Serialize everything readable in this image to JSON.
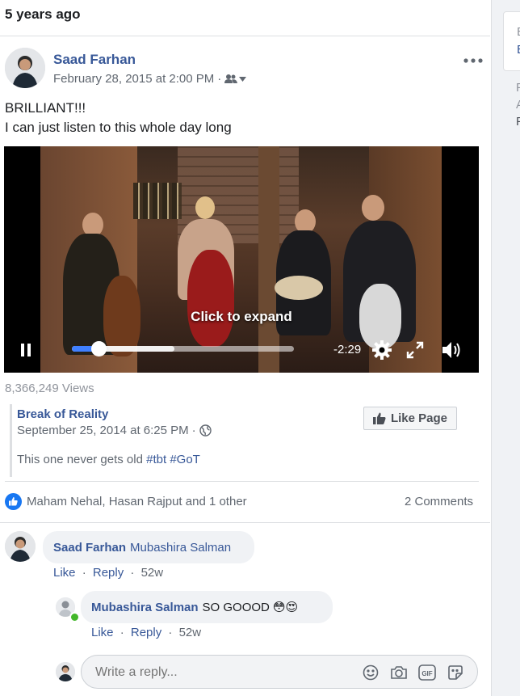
{
  "header": {
    "timeago": "5 years ago"
  },
  "post": {
    "author": "Saad Farhan",
    "date": "February 28, 2015 at 2:00 PM",
    "date_sep": "·",
    "text_line1": "BRILLIANT!!!",
    "text_line2": "I can just listen to this whole day long",
    "more_icon": "ellipsis-icon",
    "privacy_icon": "friends-icon"
  },
  "video": {
    "overlay_text": "Click to expand",
    "time_remaining": "-2:29",
    "progress_fraction": 0.12,
    "buffered_fraction": 0.46
  },
  "views": "8,366,249 Views",
  "shared_page": {
    "name": "Break of Reality",
    "date": "September 25, 2014 at 6:25 PM",
    "date_sep": "·",
    "text": "This one never gets old",
    "hashtags": [
      "#tbt",
      "#GoT"
    ],
    "like_page_label": "Like Page"
  },
  "reactions": {
    "summary": "Maham Nehal, Hasan Rajput and 1 other",
    "comments_count": "2 Comments"
  },
  "comments": [
    {
      "author": "Saad Farhan",
      "text": "Mubashira Salman",
      "like": "Like",
      "reply": "Reply",
      "time": "52w",
      "sep": "·"
    },
    {
      "author": "Mubashira Salman",
      "text": "SO GOOOD",
      "emojis": "😳😍",
      "like": "Like",
      "reply": "Reply",
      "time": "52w",
      "sep": "·"
    }
  ],
  "reply_box": {
    "placeholder": "Write a reply..."
  },
  "sidebar": {
    "letters": [
      "E",
      "E",
      "F",
      "A",
      "F"
    ]
  },
  "colors": {
    "link": "#385898",
    "accent": "#4080ff",
    "like_blue": "#1877f2"
  }
}
